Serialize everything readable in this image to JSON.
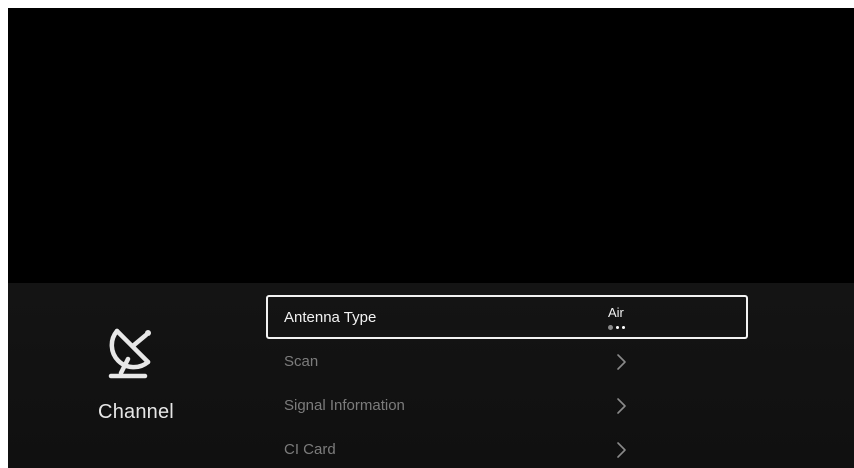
{
  "category": {
    "label": "Channel",
    "icon": "satellite-dish-icon"
  },
  "menu": {
    "items": [
      {
        "label": "Antenna Type",
        "value": "Air",
        "focused": true,
        "control": "option-selector",
        "option_count": 3,
        "selected_index": 0
      },
      {
        "label": "Scan",
        "control": "chevron-right-icon"
      },
      {
        "label": "Signal Information",
        "control": "chevron-right-icon"
      },
      {
        "label": "CI Card",
        "control": "chevron-right-icon"
      }
    ]
  },
  "colors": {
    "background": "#000000",
    "panel": "#121212",
    "focus_border": "#f2f2f2",
    "text_active": "#f2f2f2",
    "text_inactive": "#7c7c7c"
  }
}
